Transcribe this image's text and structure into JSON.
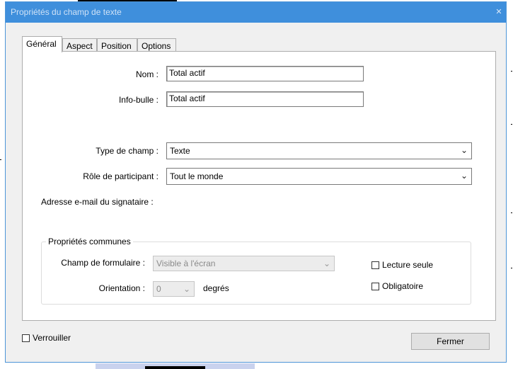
{
  "window": {
    "title": "Propriétés du champ de texte",
    "close_icon": "close-icon"
  },
  "tabs": [
    {
      "label": "Général",
      "active": true
    },
    {
      "label": "Aspect",
      "active": false
    },
    {
      "label": "Position",
      "active": false
    },
    {
      "label": "Options",
      "active": false
    }
  ],
  "general": {
    "name_label": "Nom :",
    "name_value": "Total actif",
    "tooltip_label": "Info-bulle :",
    "tooltip_value": "Total actif",
    "field_type_label": "Type de champ :",
    "field_type_value": "Texte",
    "role_label": "Rôle de participant :",
    "role_value": "Tout le monde",
    "signer_email_label": "Adresse e-mail du signataire :"
  },
  "common": {
    "title": "Propriétés communes",
    "form_field_label": "Champ de formulaire :",
    "form_field_value": "Visible à l'écran",
    "orientation_label": "Orientation :",
    "orientation_value": "0",
    "orientation_unit": "degrés",
    "read_only_label": "Lecture seule",
    "read_only_checked": false,
    "required_label": "Obligatoire",
    "required_checked": false
  },
  "footer": {
    "lock_label": "Verrouiller",
    "lock_checked": false,
    "close_button": "Fermer"
  },
  "colors": {
    "titlebar": "#3f8fdc",
    "dialog_bg": "#f0f0f0",
    "panel_bg": "#ffffff"
  }
}
